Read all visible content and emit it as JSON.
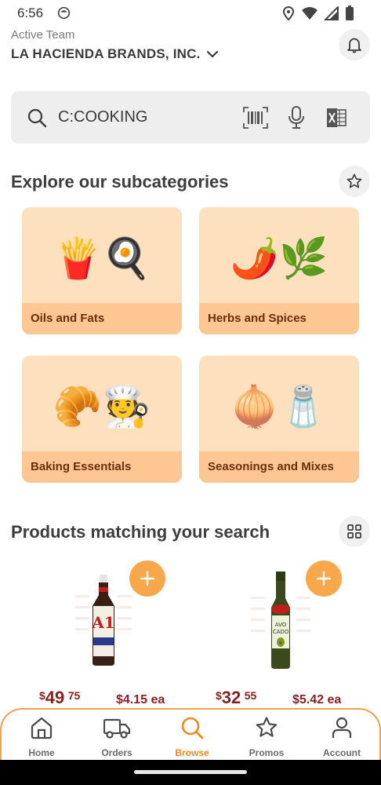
{
  "status_bar": {
    "time": "6:56"
  },
  "header": {
    "team_label": "Active Team",
    "team_name": "LA HACIENDA BRANDS, INC."
  },
  "search": {
    "value": "C:COOKING",
    "placeholder": ""
  },
  "subcategories": {
    "title": "Explore our subcategories",
    "items": [
      {
        "label": "Oils and Fats",
        "emoji": "🍟🍳"
      },
      {
        "label": "Herbs and Spices",
        "emoji": "🌶️🌿"
      },
      {
        "label": "Baking Essentials",
        "emoji": "🥐🧑‍🍳"
      },
      {
        "label": "Seasonings and Mixes",
        "emoji": "🧅🧂"
      }
    ]
  },
  "products": {
    "title": "Products matching your search",
    "items": [
      {
        "currency": "$",
        "dollars": "49",
        "cents": "75",
        "unit_price": "$4.15 ea"
      },
      {
        "currency": "$",
        "dollars": "32",
        "cents": "55",
        "unit_price": "$5.42 ea"
      }
    ]
  },
  "nav": {
    "items": [
      {
        "label": "Home",
        "icon": "home-icon"
      },
      {
        "label": "Orders",
        "icon": "truck-icon"
      },
      {
        "label": "Browse",
        "icon": "search-icon",
        "active": true
      },
      {
        "label": "Promos",
        "icon": "star-icon"
      },
      {
        "label": "Account",
        "icon": "person-icon"
      }
    ]
  },
  "colors": {
    "accent": "#f08a24",
    "card_bg": "#fde0bd",
    "card_label_bg": "#fcc793",
    "price": "#8a1f1f"
  }
}
